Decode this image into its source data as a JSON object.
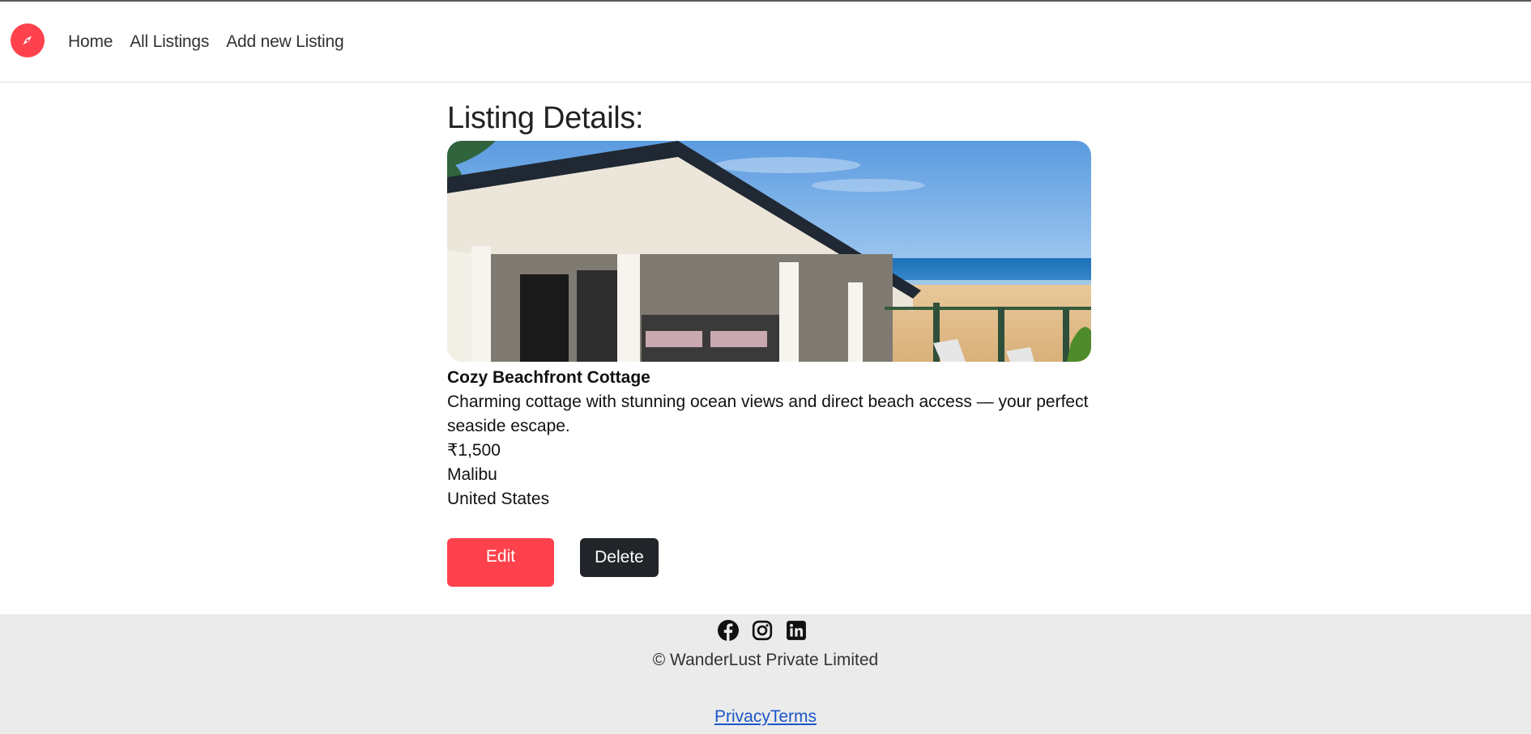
{
  "navbar": {
    "brand_icon": "compass-icon",
    "brand_color": "#fe424d",
    "links": [
      "Home",
      "All Listings",
      "Add new Listing"
    ]
  },
  "main": {
    "title": "Listing Details:",
    "listing": {
      "title": "Cozy Beachfront Cottage",
      "description": "Charming cottage with stunning ocean views and direct beach access — your perfect seaside escape.",
      "price": "₹1,500",
      "location": "Malibu",
      "country": "United States"
    },
    "edit_label": "Edit",
    "delete_label": "Delete",
    "edit_color": "#fe424d",
    "delete_color": "#212529"
  },
  "footer": {
    "social_icons": [
      "facebook-icon",
      "instagram-icon",
      "linkedin-icon"
    ],
    "copyright": "© WanderLust Private Limited",
    "privacy_label": "Privacy",
    "terms_label": "Terms"
  }
}
